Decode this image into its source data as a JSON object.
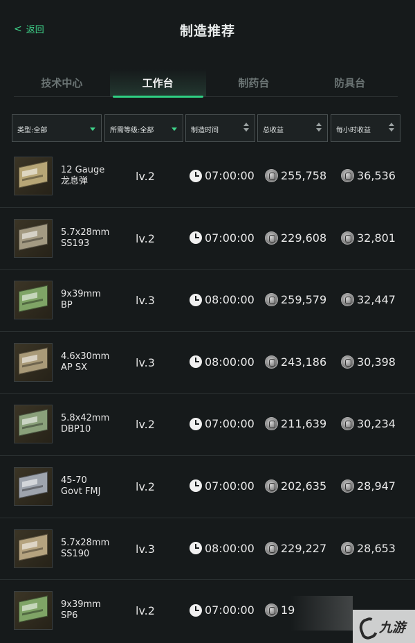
{
  "header": {
    "back_label": "返回",
    "title": "制造推荐"
  },
  "tabs": [
    {
      "label": "技术中心",
      "active": false
    },
    {
      "label": "工作台",
      "active": true
    },
    {
      "label": "制药台",
      "active": false
    },
    {
      "label": "防具台",
      "active": false
    }
  ],
  "filters": {
    "type": "类型:全部",
    "level": "所需等级:全部",
    "time": "制造时间",
    "total": "总收益",
    "hourly": "每小时收益"
  },
  "colors": {
    "accent": "#2fd083",
    "background": "#161a1b"
  },
  "rows": [
    {
      "name1": "12 Gauge",
      "name2": "龙息弹",
      "level": "lv.2",
      "time": "07:00:00",
      "total": "255,758",
      "hourly": "36,536",
      "box_color": "#b7a676"
    },
    {
      "name1": "5.7x28mm",
      "name2": "SS193",
      "level": "lv.2",
      "time": "07:00:00",
      "total": "229,608",
      "hourly": "32,801",
      "box_color": "#a39a82"
    },
    {
      "name1": "9x39mm",
      "name2": "BP",
      "level": "lv.3",
      "time": "08:00:00",
      "total": "259,579",
      "hourly": "32,447",
      "box_color": "#7fa466"
    },
    {
      "name1": "4.6x30mm",
      "name2": "AP SX",
      "level": "lv.3",
      "time": "08:00:00",
      "total": "243,186",
      "hourly": "30,398",
      "box_color": "#a99a78"
    },
    {
      "name1": "5.8x42mm",
      "name2": "DBP10",
      "level": "lv.2",
      "time": "07:00:00",
      "total": "211,639",
      "hourly": "30,234",
      "box_color": "#8aa07a"
    },
    {
      "name1": "45-70",
      "name2": "Govt FMJ",
      "level": "lv.2",
      "time": "07:00:00",
      "total": "202,635",
      "hourly": "28,947",
      "box_color": "#9ea4ad"
    },
    {
      "name1": "5.7x28mm",
      "name2": "SS190",
      "level": "lv.3",
      "time": "08:00:00",
      "total": "229,227",
      "hourly": "28,653",
      "box_color": "#b5a37f"
    },
    {
      "name1": "9x39mm",
      "name2": "SP6",
      "level": "lv.2",
      "time": "07:00:00",
      "total": "19",
      "hourly": "",
      "box_color": "#7fa466"
    }
  ],
  "watermark": {
    "text": "九游",
    "icon": "jiuyou-logo-icon"
  }
}
